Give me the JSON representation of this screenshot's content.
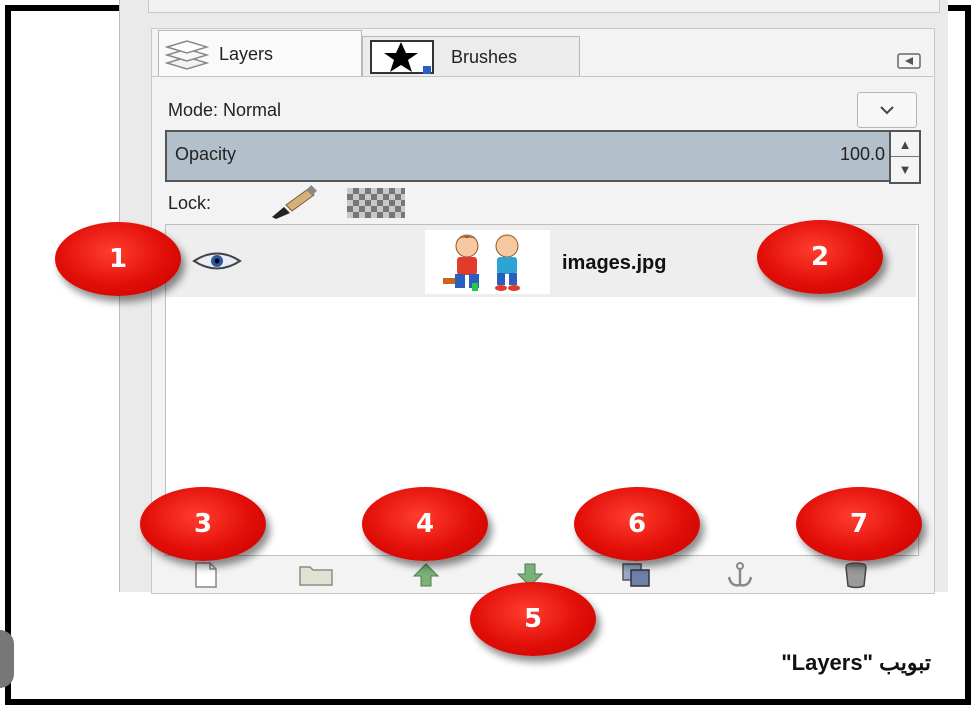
{
  "tabs": [
    {
      "label": "Layers",
      "icon": "layers-stack-icon",
      "active": true
    },
    {
      "label": "Brushes",
      "icon": "star-brush-icon",
      "active": false
    }
  ],
  "panel": {
    "menu_icon": "panel-menu-icon",
    "mode_label": "Mode: Normal",
    "opacity_label": "Opacity",
    "opacity_value": "100.0",
    "lock_label": "Lock:"
  },
  "layers": [
    {
      "name": "images.jpg",
      "visible": true,
      "visibility_icon": "eye-icon",
      "thumbnail": "cartoon-kids-thumbnail"
    }
  ],
  "bottom_toolbar": [
    {
      "action": "new-layer",
      "icon": "new-page-icon"
    },
    {
      "action": "new-layer-group",
      "icon": "folder-icon"
    },
    {
      "action": "raise-layer",
      "icon": "arrow-up-icon"
    },
    {
      "action": "lower-layer",
      "icon": "arrow-down-icon"
    },
    {
      "action": "duplicate-layer",
      "icon": "duplicate-icon"
    },
    {
      "action": "anchor-layer",
      "icon": "anchor-icon"
    },
    {
      "action": "delete-layer",
      "icon": "trash-icon"
    }
  ],
  "badges": [
    "1",
    "2",
    "3",
    "4",
    "5",
    "6",
    "7"
  ],
  "caption": "تبويب \"Layers\"",
  "colors": {
    "badge": "#e10e08",
    "opacity_fill": "#b3c0cc",
    "frame": "#000000"
  }
}
